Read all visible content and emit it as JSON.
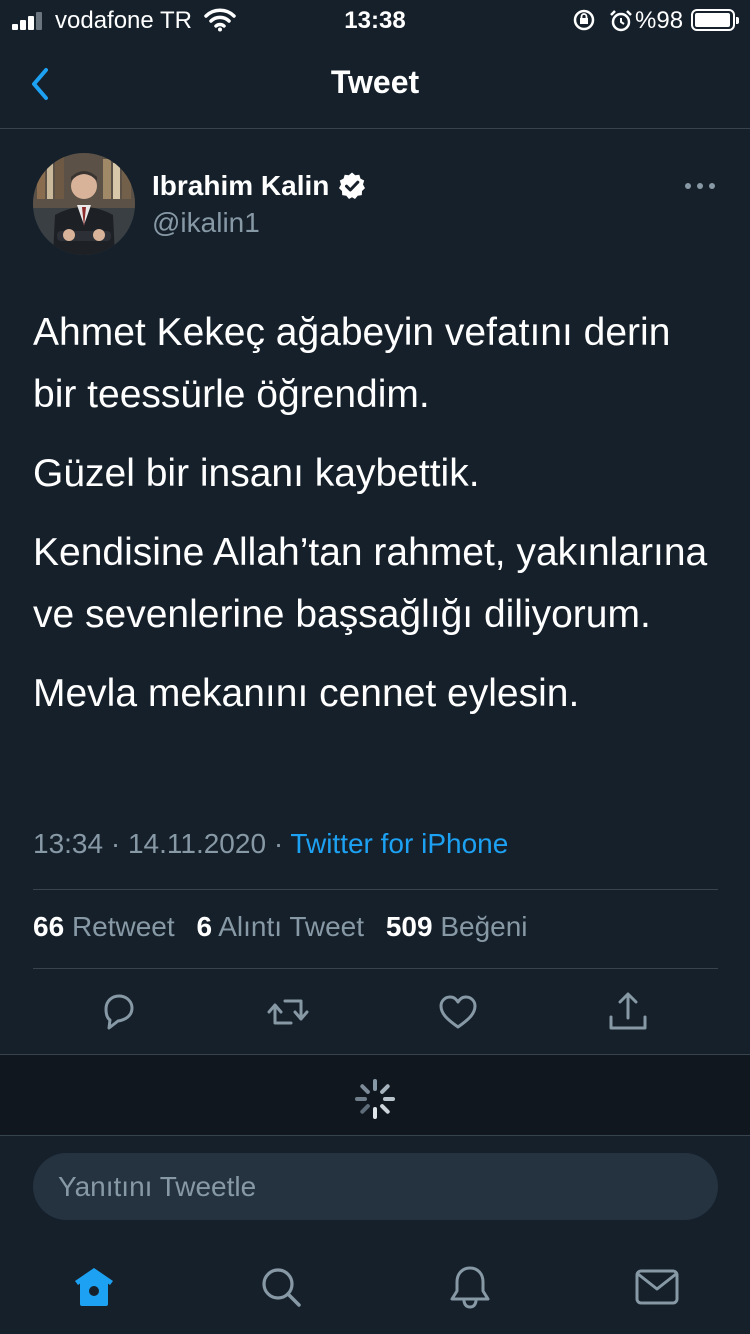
{
  "status_bar": {
    "carrier": "vodafone TR",
    "time": "13:38",
    "battery_text": "%98",
    "battery_level": 0.98,
    "icons": [
      "signal-icon",
      "wifi-icon",
      "orientation-lock-icon",
      "alarm-icon",
      "battery-icon"
    ]
  },
  "header": {
    "back_icon": "chevron-left-icon",
    "title": "Tweet"
  },
  "author": {
    "name": "Ibrahim Kalin",
    "handle": "@ikalin1",
    "verified": true
  },
  "tweet": {
    "paragraphs": [
      "Ahmet Kekeç ağabeyin vefatını derin bir teessürle öğrendim.",
      "Güzel bir insanı kaybettik.",
      "Kendisine Allah’tan rahmet, yakınlarına ve sevenlerine başsağlığı diliyorum.",
      "Mevla mekanını cennet eylesin."
    ],
    "time": "13:34",
    "date": "14.11.2020",
    "separator": "·",
    "source": "Twitter for iPhone"
  },
  "stats": {
    "retweets": {
      "count": "66",
      "label": "Retweet"
    },
    "quotes": {
      "count": "6",
      "label": "Alıntı Tweet"
    },
    "likes": {
      "count": "509",
      "label": "Beğeni"
    }
  },
  "actions": [
    "reply-icon",
    "retweet-icon",
    "like-icon",
    "share-icon"
  ],
  "reply": {
    "placeholder": "Yanıtını Tweetle"
  },
  "tabbar": [
    "home-icon",
    "search-icon",
    "notifications-icon",
    "messages-icon"
  ],
  "colors": {
    "background": "#15202b",
    "accent": "#1da1f2",
    "secondary_text": "#8899a6",
    "border": "#38444d"
  }
}
